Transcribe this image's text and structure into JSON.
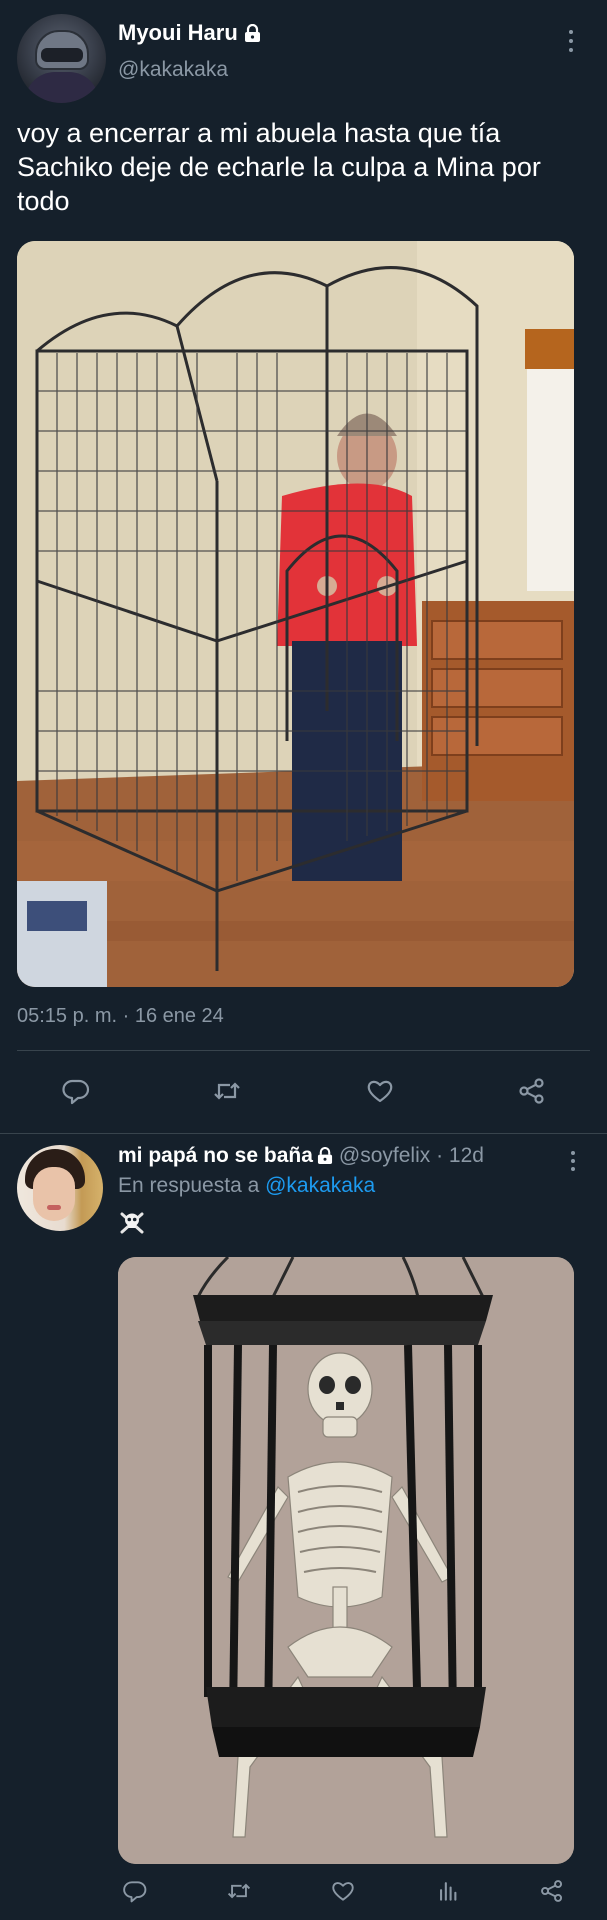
{
  "tweet": {
    "author": {
      "display_name": "Myoui Haru",
      "handle": "@kakakaka",
      "protected_icon": "lock-icon",
      "avatar": "avatar-helmet"
    },
    "text": "voy a encerrar a mi abuela hasta que tía Sachiko deje de echarle la culpa a Mina por todo",
    "media": "photo of grandmother inside a large metal bird cage in a bedroom",
    "timestamp": "05:15 p. m. · 16 ene 24",
    "actions": [
      {
        "name": "reply",
        "icon": "reply-icon"
      },
      {
        "name": "retweet",
        "icon": "retweet-icon"
      },
      {
        "name": "like",
        "icon": "heart-icon"
      },
      {
        "name": "share",
        "icon": "share-icon"
      }
    ]
  },
  "reply": {
    "author": {
      "display_name": "mi papá no se baña",
      "handle": "@soyfelix",
      "protected_icon": "lock-icon",
      "avatar": "avatar-person"
    },
    "separator": "·",
    "time": "12d",
    "in_reply_to_prefix": "En respuesta a",
    "in_reply_to_handle": "@kakakaka",
    "text_emoji": "☠️",
    "media": "photo of a skeleton sitting in a hanging black cage",
    "actions": [
      {
        "name": "reply",
        "icon": "reply-icon"
      },
      {
        "name": "retweet",
        "icon": "retweet-icon"
      },
      {
        "name": "like",
        "icon": "heart-icon"
      },
      {
        "name": "views",
        "icon": "analytics-icon"
      },
      {
        "name": "share",
        "icon": "share-icon"
      }
    ]
  },
  "colors": {
    "background": "#15202b",
    "text_primary": "#ffffff",
    "text_secondary": "#8b98a5",
    "link": "#1d9bf0",
    "divider": "#38444d"
  }
}
